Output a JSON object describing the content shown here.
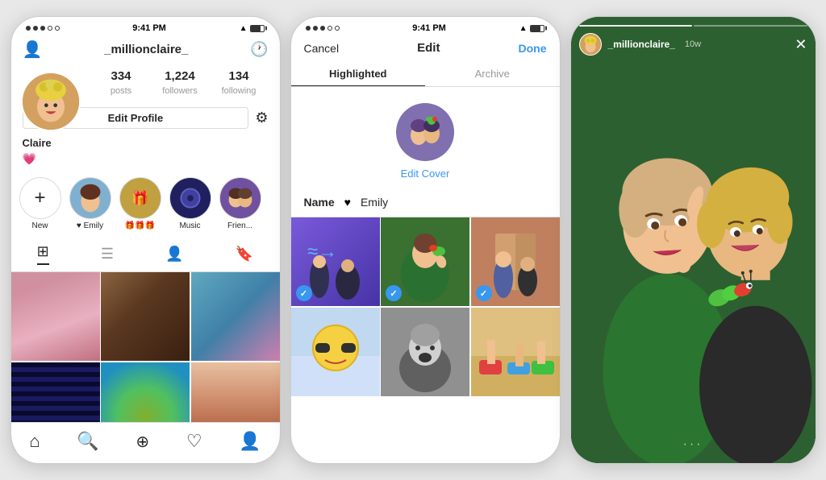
{
  "phone1": {
    "status": {
      "dots": "●●●○○",
      "time": "9:41 PM",
      "signal": "▲"
    },
    "nav": {
      "username": "_millionclaire_",
      "left_icon": "👤+",
      "right_icon": "🕐"
    },
    "stats": {
      "posts_count": "334",
      "posts_label": "posts",
      "followers_count": "1,224",
      "followers_label": "followers",
      "following_count": "134",
      "following_label": "following"
    },
    "edit_profile_label": "Edit Profile",
    "name": "Claire",
    "emoji": "💗",
    "stories": [
      {
        "label": "New",
        "type": "new"
      },
      {
        "label": "♥ Emily",
        "type": "emily"
      },
      {
        "label": "🎁🎁🎁",
        "type": "gifts"
      },
      {
        "label": "Music",
        "type": "music"
      },
      {
        "label": "Frien...",
        "type": "friends"
      }
    ],
    "tabs": [
      "grid",
      "list",
      "person",
      "bookmark"
    ],
    "bottom_nav": [
      "home",
      "search",
      "plus",
      "heart",
      "person"
    ]
  },
  "phone2": {
    "status": {
      "time": "9:41 PM"
    },
    "header": {
      "cancel": "Cancel",
      "title": "Edit",
      "done": "Done"
    },
    "tabs": [
      "Highlighted",
      "Archive"
    ],
    "active_tab": "Highlighted",
    "edit_cover": "Edit Cover",
    "name_label": "Name",
    "name_heart": "♥",
    "name_value": "Emily",
    "grid_cells": [
      {
        "checked": true,
        "color": "story1"
      },
      {
        "checked": true,
        "color": "story2"
      },
      {
        "checked": true,
        "color": "emily"
      },
      {
        "checked": false,
        "color": "yellow"
      },
      {
        "checked": false,
        "color": "selfie"
      },
      {
        "checked": false,
        "color": "colorful"
      }
    ]
  },
  "phone3": {
    "username": "_millionclaire_",
    "time": "10w",
    "close": "✕",
    "more": "···"
  },
  "colors": {
    "blue_accent": "#3897f0",
    "text_primary": "#262626",
    "border": "#dbdbdb"
  }
}
